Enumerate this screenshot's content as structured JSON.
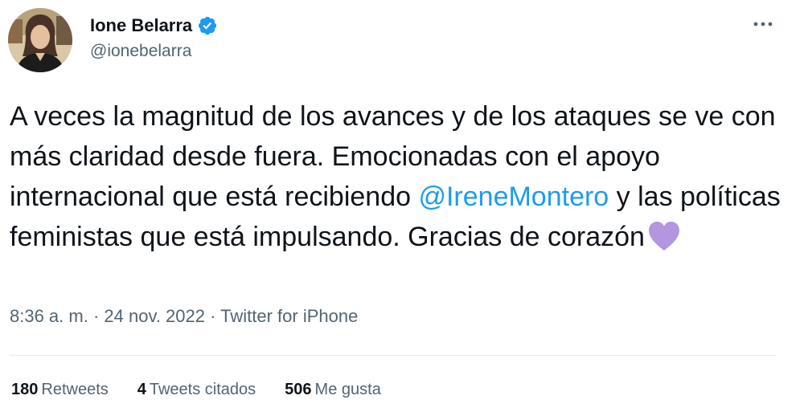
{
  "author": {
    "display_name": "Ione Belarra",
    "handle": "@ionebelarra",
    "verified": true,
    "avatar_icon": "profile-photo"
  },
  "tweet": {
    "text_before": "A veces la magnitud de los avances y de los ataques se ve con más claridad desde fuera. Emocionadas con el apoyo internacional que está recibiendo ",
    "mention": "@IreneMontero",
    "text_after": " y las políticas feministas que está impulsando. Gracias de corazón",
    "emoji": "purple-heart-icon"
  },
  "meta": {
    "time": "8:36 a. m.",
    "separator": " · ",
    "date": "24 nov. 2022",
    "source": "Twitter for iPhone"
  },
  "stats": {
    "retweets_count": "180",
    "retweets_label": "Retweets",
    "quotes_count": "4",
    "quotes_label": "Tweets citados",
    "likes_count": "506",
    "likes_label": "Me gusta"
  },
  "colors": {
    "link": "#1d9bf0",
    "secondary_text": "#536471",
    "primary_text": "#0f1419",
    "heart": "#b395e0"
  }
}
